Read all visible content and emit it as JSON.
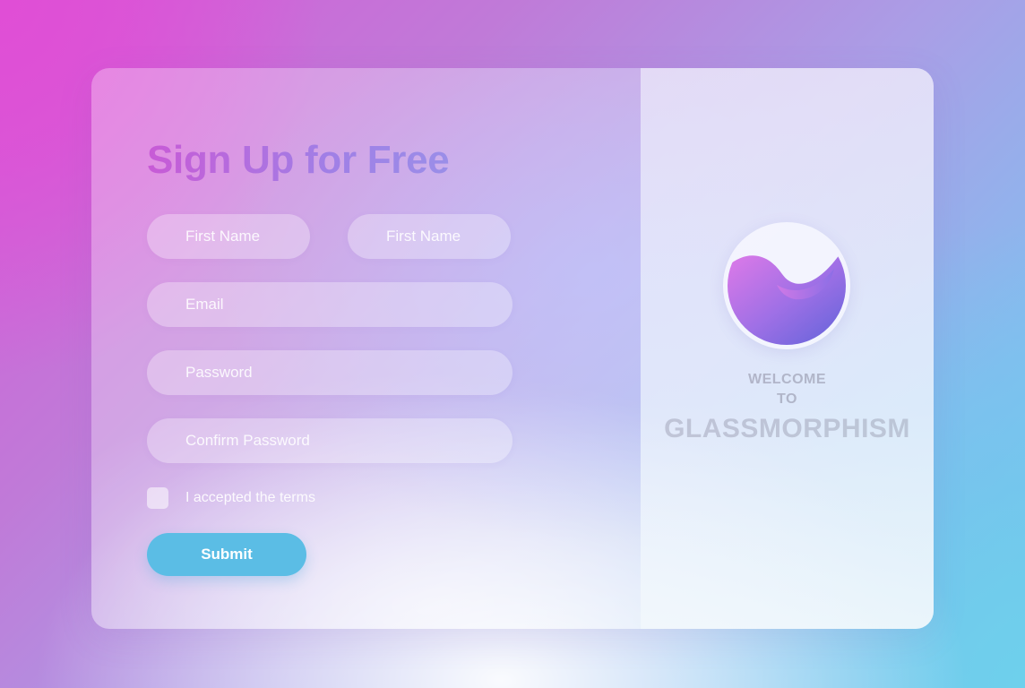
{
  "form": {
    "title": "Sign Up for Free",
    "first_name_1_placeholder": "First Name",
    "first_name_2_placeholder": "First Name",
    "email_placeholder": "Email",
    "password_placeholder": "Password",
    "confirm_password_placeholder": "Confirm Password",
    "terms_label": "I accepted the terms",
    "terms_checked": false,
    "submit_label": "Submit"
  },
  "welcome_panel": {
    "line1": "WELCOME",
    "line2": "TO",
    "brand": "GLASSMORPHISM",
    "logo_icon": "wave-sphere-logo-icon"
  },
  "colors": {
    "title_gradient_start": "#c85ad6",
    "title_gradient_end": "#9a8ee8",
    "submit_button": "#5bbde5",
    "logo_gradient_start": "#e07ae8",
    "logo_gradient_end": "#5a62d8"
  }
}
